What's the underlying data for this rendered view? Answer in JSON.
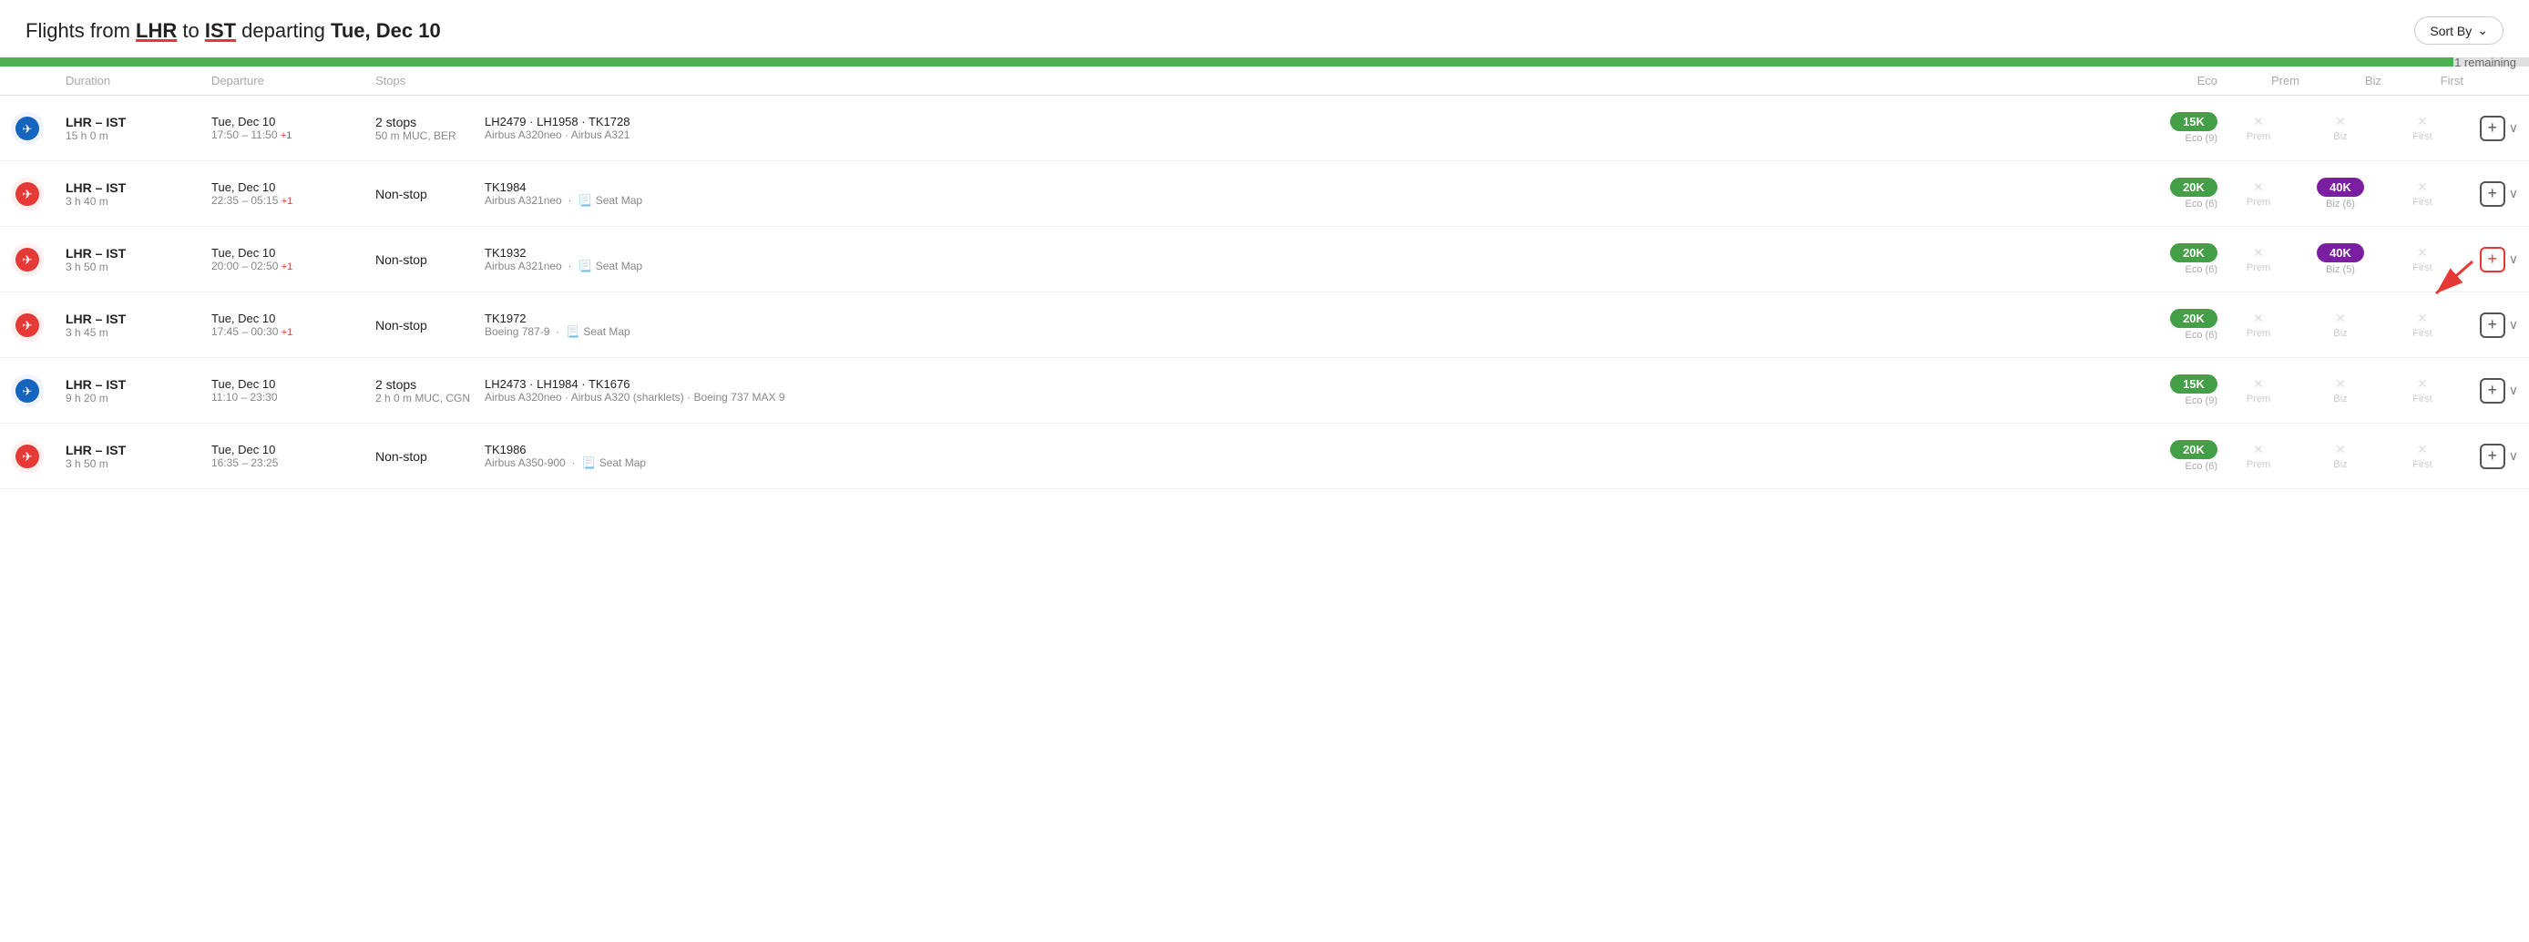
{
  "header": {
    "title_prefix": "Flights from ",
    "origin": "LHR",
    "title_middle": " to ",
    "destination": "IST",
    "title_suffix": " departing ",
    "date": "Tue, Dec 10",
    "sort_by": "Sort By"
  },
  "progress": {
    "remaining": "1 remaining",
    "fill_pct": 97
  },
  "table": {
    "headers": {
      "duration": "Duration",
      "departure": "Departure",
      "stops": "Stops",
      "eco": "Eco",
      "prem": "Prem",
      "biz": "Biz",
      "first": "First"
    }
  },
  "flights": [
    {
      "id": 1,
      "airline_type": "lufthansa",
      "airline_symbol": "✈",
      "route": "LHR – IST",
      "duration": "15 h 0 m",
      "departure_date": "Tue, Dec 10",
      "departure_time": "17:50 – 11:50 +1",
      "has_next_day": true,
      "stops_label": "2 stops",
      "stops_detail": "50 m MUC, BER",
      "flight_numbers": "LH2479 · LH1958 · TK1728",
      "aircraft": "Airbus A320neo · Airbus A321",
      "has_seat_map": false,
      "eco_price": "15K",
      "eco_badge": "green",
      "eco_sub": "Eco (9)",
      "prem_available": false,
      "prem_label": "Prem",
      "biz_available": false,
      "biz_label": "Biz",
      "first_available": false,
      "first_label": "First"
    },
    {
      "id": 2,
      "airline_type": "turkish",
      "airline_symbol": "✈",
      "route": "LHR – IST",
      "duration": "3 h 40 m",
      "departure_date": "Tue, Dec 10",
      "departure_time": "22:35 – 05:15 +1",
      "has_next_day": true,
      "stops_label": "Non-stop",
      "stops_detail": "",
      "flight_numbers": "TK1984",
      "aircraft": "Airbus A321neo",
      "has_seat_map": true,
      "eco_price": "20K",
      "eco_badge": "green",
      "eco_sub": "Eco (6)",
      "prem_available": false,
      "prem_label": "Prem",
      "biz_available": true,
      "biz_price": "40K",
      "biz_badge": "purple",
      "biz_sub": "Biz (6)",
      "first_available": false,
      "first_label": "First"
    },
    {
      "id": 3,
      "airline_type": "turkish",
      "airline_symbol": "✈",
      "route": "LHR – IST",
      "duration": "3 h 50 m",
      "departure_date": "Tue, Dec 10",
      "departure_time": "20:00 – 02:50 +1",
      "has_next_day": true,
      "stops_label": "Non-stop",
      "stops_detail": "",
      "flight_numbers": "TK1932",
      "aircraft": "Airbus A321neo",
      "has_seat_map": true,
      "eco_price": "20K",
      "eco_badge": "green",
      "eco_sub": "Eco (6)",
      "prem_available": false,
      "prem_label": "Prem",
      "biz_available": true,
      "biz_price": "40K",
      "biz_badge": "purple",
      "biz_sub": "Biz (5)",
      "first_available": false,
      "first_label": "First",
      "highlighted": true
    },
    {
      "id": 4,
      "airline_type": "turkish",
      "airline_symbol": "✈",
      "route": "LHR – IST",
      "duration": "3 h 45 m",
      "departure_date": "Tue, Dec 10",
      "departure_time": "17:45 – 00:30 +1",
      "has_next_day": true,
      "stops_label": "Non-stop",
      "stops_detail": "",
      "flight_numbers": "TK1972",
      "aircraft": "Boeing 787-9",
      "has_seat_map": true,
      "eco_price": "20K",
      "eco_badge": "green",
      "eco_sub": "Eco (6)",
      "prem_available": false,
      "prem_label": "Prem",
      "biz_available": false,
      "biz_label": "Biz",
      "first_available": false,
      "first_label": "First"
    },
    {
      "id": 5,
      "airline_type": "lufthansa",
      "airline_symbol": "✈",
      "route": "LHR – IST",
      "duration": "9 h 20 m",
      "departure_date": "Tue, Dec 10",
      "departure_time": "11:10 – 23:30",
      "has_next_day": false,
      "stops_label": "2 stops",
      "stops_detail": "2 h 0 m MUC, CGN",
      "flight_numbers": "LH2473 · LH1984 · TK1676",
      "aircraft": "Airbus A320neo · Airbus A320 (sharklets) · Boeing 737 MAX 9",
      "has_seat_map": false,
      "eco_price": "15K",
      "eco_badge": "green",
      "eco_sub": "Eco (9)",
      "prem_available": false,
      "prem_label": "Prem",
      "biz_available": false,
      "biz_label": "Biz",
      "first_available": false,
      "first_label": "First"
    },
    {
      "id": 6,
      "airline_type": "turkish",
      "airline_symbol": "✈",
      "route": "LHR – IST",
      "duration": "3 h 50 m",
      "departure_date": "Tue, Dec 10",
      "departure_time": "16:35 – 23:25",
      "has_next_day": false,
      "stops_label": "Non-stop",
      "stops_detail": "",
      "flight_numbers": "TK1986",
      "aircraft": "Airbus A350-900",
      "has_seat_map": true,
      "eco_price": "20K",
      "eco_badge": "green",
      "eco_sub": "Eco (6)",
      "prem_available": false,
      "prem_label": "Prem",
      "biz_available": false,
      "biz_label": "Biz",
      "first_available": false,
      "first_label": "First"
    }
  ]
}
